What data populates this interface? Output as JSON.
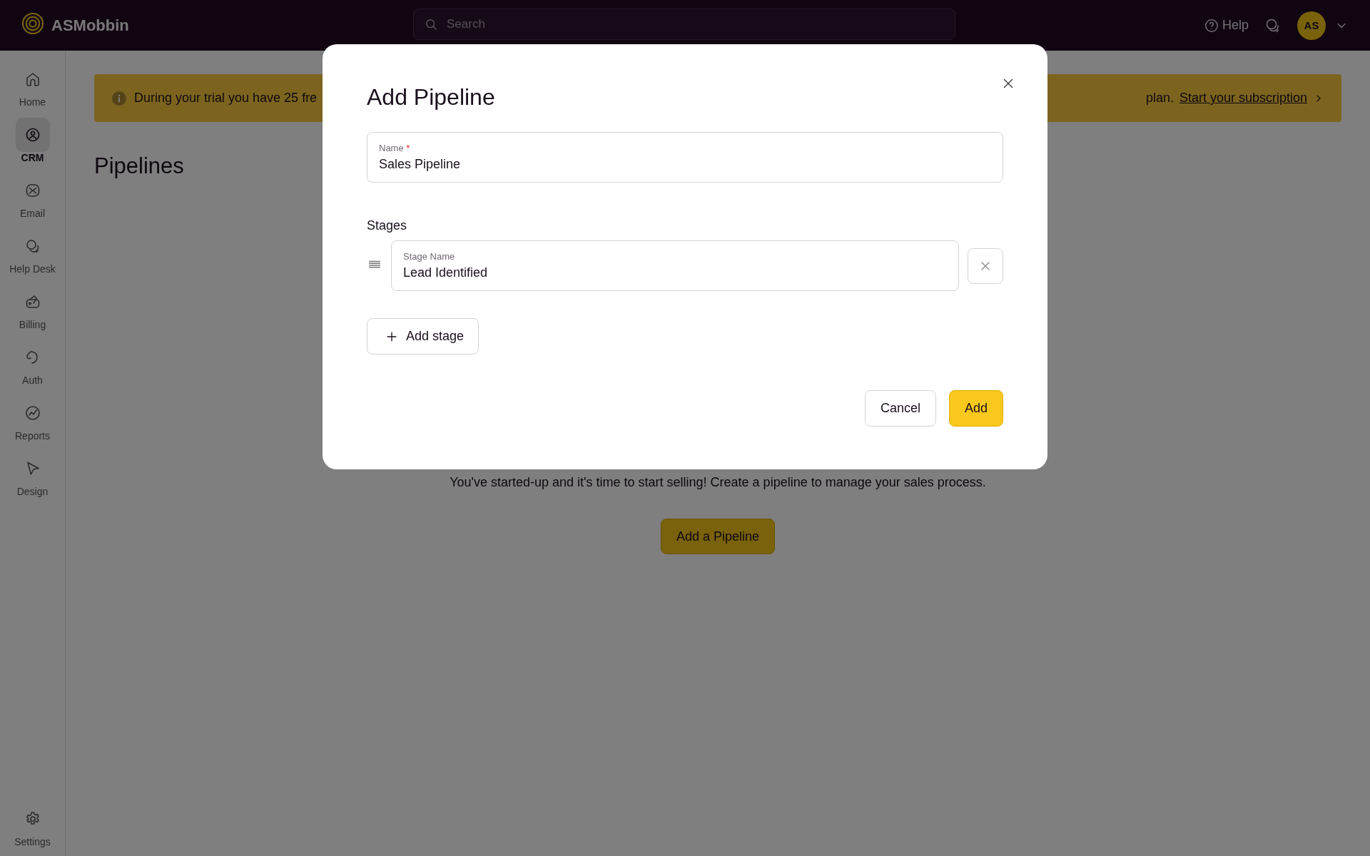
{
  "topbar": {
    "brand": "ASMobbin",
    "search": {
      "placeholder": "Search"
    },
    "help": "Help",
    "avatar": "AS"
  },
  "sidebar": {
    "items": [
      {
        "label": "Home",
        "selected": false
      },
      {
        "label": "CRM",
        "selected": true
      },
      {
        "label": "Email",
        "selected": false
      },
      {
        "label": "Help Desk",
        "selected": false
      },
      {
        "label": "Billing",
        "selected": false
      },
      {
        "label": "Auth",
        "selected": false
      },
      {
        "label": "Reports",
        "selected": false
      },
      {
        "label": "Design",
        "selected": false
      }
    ],
    "footer": {
      "label": "Settings"
    }
  },
  "banner": {
    "text_start": "During your trial you have 25 fre",
    "text_end": "plan.",
    "link": "Start your subscription"
  },
  "page": {
    "title": "Pipelines",
    "message": "You've started-up and it's time to start selling! Create a pipeline to manage your sales process.",
    "button": "Add a Pipeline"
  },
  "dialog": {
    "title": "Add Pipeline",
    "name_field": {
      "label": "Name",
      "required_mark": "*",
      "value": "Sales Pipeline"
    },
    "stages_heading": "Stages",
    "stages": [
      {
        "label": "Stage Name",
        "value": "Lead Identified"
      }
    ],
    "add_stage": "Add stage",
    "buttons": [
      {
        "label": "Cancel",
        "kind": "secondary"
      },
      {
        "label": "Add",
        "kind": "primary"
      }
    ]
  }
}
